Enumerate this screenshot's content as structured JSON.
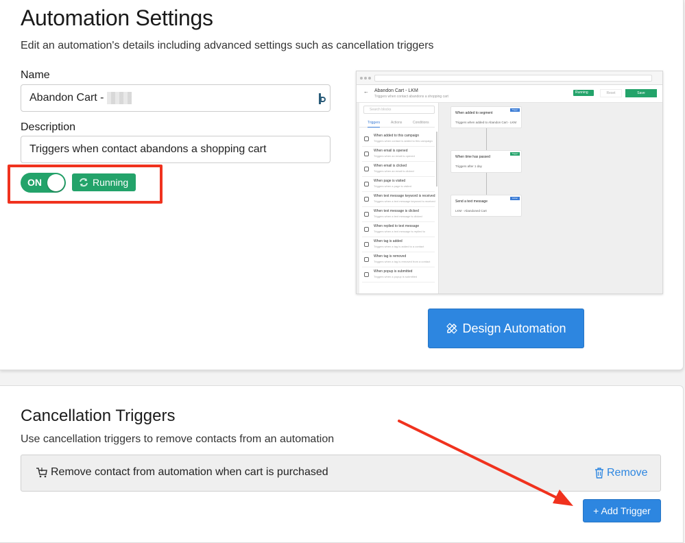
{
  "settings": {
    "title": "Automation Settings",
    "subtitle": "Edit an automation's details including advanced settings such as cancellation triggers",
    "name_label": "Name",
    "name_value": "Abandon Cart -",
    "description_label": "Description",
    "description_value": "Triggers when contact abandons a shopping cart",
    "toggle_label": "ON",
    "status_label": "Running",
    "design_button": "Design Automation"
  },
  "preview": {
    "title": "Abandon Cart - LKM",
    "subtitle": "Triggers when contact abandons a shopping cart",
    "status": "Running",
    "reset": "Reset",
    "save": "Save",
    "search_placeholder": "Search blocks",
    "tabs": [
      "Triggers",
      "Actions",
      "Conditions"
    ],
    "blocks": [
      {
        "title": "When added to this campaign",
        "desc": "Triggers when contact is added to this campaign"
      },
      {
        "title": "When email is opened",
        "desc": "Triggers when an email is opened"
      },
      {
        "title": "When email is clicked",
        "desc": "Triggers when an email is clicked"
      },
      {
        "title": "When page is visited",
        "desc": "Triggers when a page is visited"
      },
      {
        "title": "When text message keyword is received",
        "desc": "Triggers when a text message keyword is received"
      },
      {
        "title": "When text message is clicked",
        "desc": "Triggers when a text message is clicked"
      },
      {
        "title": "When replied to text message",
        "desc": "Triggers when a text message is replied to"
      },
      {
        "title": "When tag is added",
        "desc": "Triggers when a tag is added to a contact"
      },
      {
        "title": "When tag is removed",
        "desc": "Triggers when a tag is removed from a contact"
      },
      {
        "title": "When popup is submitted",
        "desc": "Triggers when a popup is submitted"
      }
    ],
    "nodes": [
      {
        "title": "When added to segment",
        "desc": "Triggers when added to Abandon Cart - LKM",
        "badge": "Trigger",
        "badge_color": "#3a7bd5"
      },
      {
        "title": "When time has passed",
        "desc": "Triggers after 1 day",
        "badge": "Trigger",
        "badge_color": "#23a36a"
      },
      {
        "title": "Send a text message",
        "desc": "LKM - Abandoned Cart",
        "badge": "Action",
        "badge_color": "#3a7bd5"
      }
    ]
  },
  "cancellation": {
    "title": "Cancellation Triggers",
    "subtitle": "Use cancellation triggers to remove contacts from an automation",
    "trigger_text": "Remove contact from automation when cart is purchased",
    "remove_label": "Remove",
    "add_button": "+ Add Trigger"
  },
  "colors": {
    "accent_green": "#23a36a",
    "accent_blue": "#2d86e0",
    "annotation_red": "#f0321e"
  }
}
